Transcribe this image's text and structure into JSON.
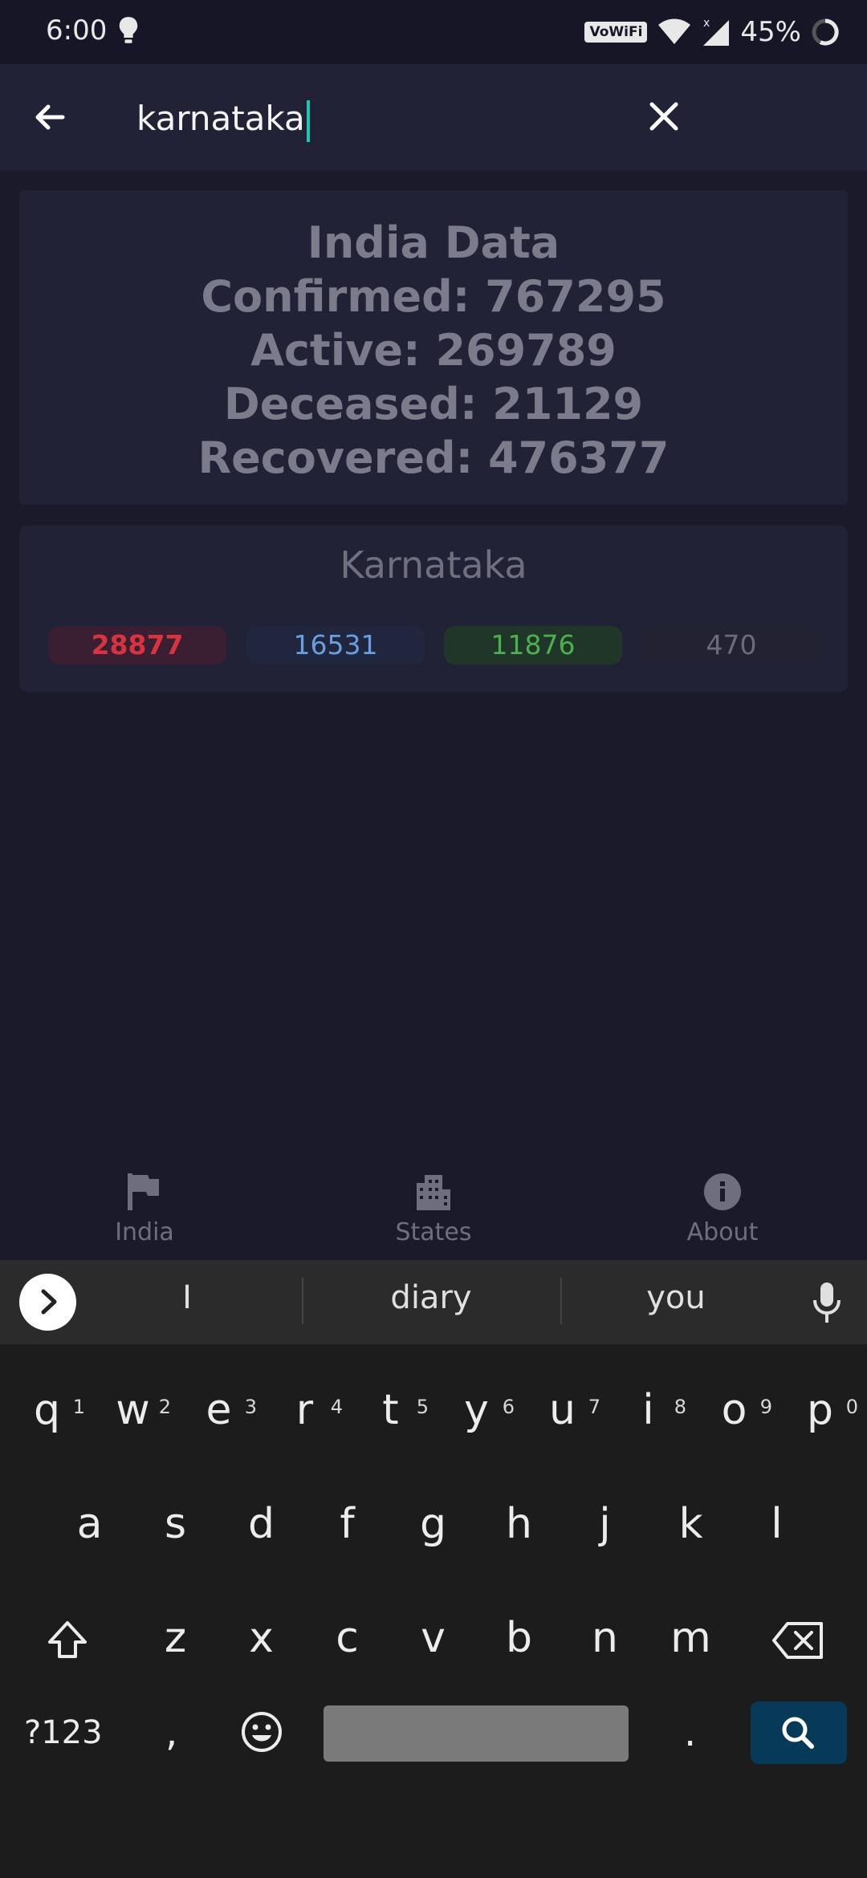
{
  "status_bar": {
    "time": "6:00",
    "wifi_badge": "VoWiFi",
    "battery": "45%"
  },
  "search": {
    "query": "karnataka"
  },
  "india_card": {
    "title": "India Data",
    "confirmed": "Confirmed: 767295",
    "active": "Active: 269789",
    "deceased": "Deceased: 21129",
    "recovered": "Recovered: 476377"
  },
  "state_card": {
    "name": "Karnataka",
    "confirmed": "28877",
    "active": "16531",
    "recovered": "11876",
    "deceased": "470"
  },
  "bottom_nav": {
    "items": [
      {
        "label": "India",
        "icon": "flag-icon"
      },
      {
        "label": "States",
        "icon": "building-icon"
      },
      {
        "label": "About",
        "icon": "info-icon"
      }
    ]
  },
  "keyboard": {
    "suggestions": [
      "I",
      "diary",
      "you"
    ],
    "row1": [
      {
        "key": "q",
        "hint": "1"
      },
      {
        "key": "w",
        "hint": "2"
      },
      {
        "key": "e",
        "hint": "3"
      },
      {
        "key": "r",
        "hint": "4"
      },
      {
        "key": "t",
        "hint": "5"
      },
      {
        "key": "y",
        "hint": "6"
      },
      {
        "key": "u",
        "hint": "7"
      },
      {
        "key": "i",
        "hint": "8"
      },
      {
        "key": "o",
        "hint": "9"
      },
      {
        "key": "p",
        "hint": "0"
      }
    ],
    "row2": [
      "a",
      "s",
      "d",
      "f",
      "g",
      "h",
      "j",
      "k",
      "l"
    ],
    "row3": [
      "z",
      "x",
      "c",
      "v",
      "b",
      "n",
      "m"
    ],
    "symbols_key": "?123",
    "comma_key": ",",
    "period_key": "."
  }
}
